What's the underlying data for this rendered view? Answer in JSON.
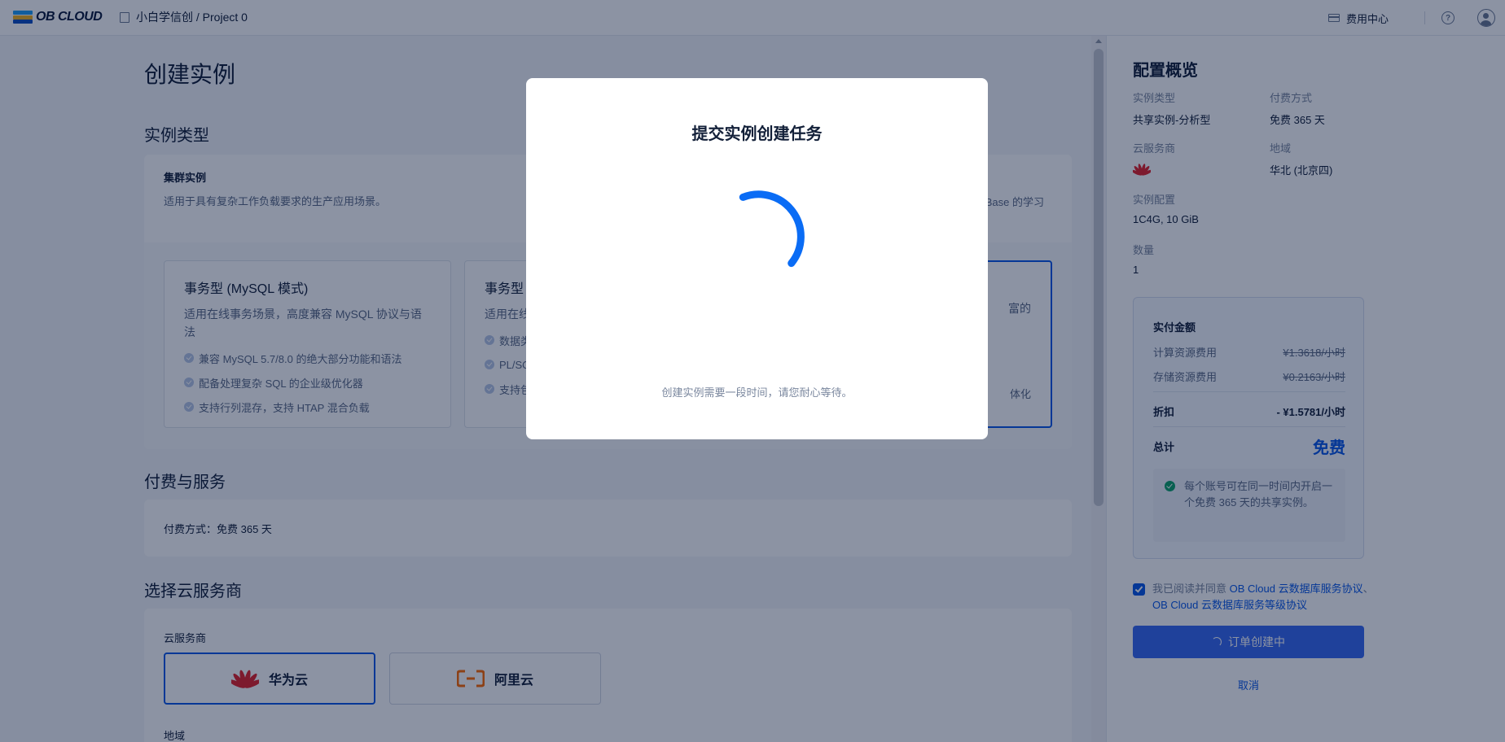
{
  "topbar": {
    "logo_text": "OB CLOUD",
    "project": "小白学信创 / Project 0",
    "billing": "费用中心",
    "help_glyph": "?"
  },
  "main": {
    "page_title": "创建实例",
    "instance_type": {
      "section": "实例类型",
      "cluster_title": "集群实例",
      "cluster_desc": "适用于具有复杂工作负载要求的生产应用场景。",
      "right_clip": "Base 的学习",
      "cards": [
        {
          "title": "事务型 (MySQL 模式)",
          "desc": "适用在线事务场景，高度兼容 MySQL 协议与语法",
          "features": [
            "兼容 MySQL 5.7/8.0 的绝大部分功能和语法",
            "配备处理复杂 SQL 的企业级优化器",
            "支持行列混存，支持 HTAP 混合负载"
          ]
        },
        {
          "title": "事务型",
          "desc": "适用在线",
          "features": [
            "数据类",
            "PL/SQ",
            "支持包"
          ]
        },
        {
          "title": "",
          "desc": "富的",
          "features": [
            "体化"
          ]
        }
      ]
    },
    "payment": {
      "section": "付费与服务",
      "text": "付费方式：免费 365 天"
    },
    "cloud": {
      "section": "选择云服务商",
      "label": "云服务商",
      "providers": [
        "华为云",
        "阿里云"
      ],
      "region_label": "地域"
    }
  },
  "sidebar": {
    "title": "配置概览",
    "instance_type_k": "实例类型",
    "instance_type_v": "共享实例-分析型",
    "pay_k": "付费方式",
    "pay_v": "免费 365 天",
    "provider_k": "云服务商",
    "region_k": "地域",
    "region_v": "华北 (北京四)",
    "spec_k": "实例配置",
    "spec_v": "1C4G, 10 GiB",
    "qty_k": "数量",
    "qty_v": "1",
    "price": {
      "title": "实付金额",
      "compute_k": "计算资源费用",
      "compute_v": "¥1.3618/小时",
      "storage_k": "存储资源费用",
      "storage_v": "¥0.2163/小时",
      "discount_k": "折扣",
      "discount_v": "- ¥1.5781/小时",
      "total_k": "总计",
      "total_v": "免费",
      "notice": "每个账号可在同一时间内开启一个免费 365 天的共享实例。"
    },
    "agree_prefix": "我已阅读并同意",
    "agree_link1": "OB Cloud 云数据库服务协议",
    "agree_sep": "、",
    "agree_link2": "OB Cloud 云数据库服务等级协议",
    "submit": "订单创建中",
    "cancel": "取消"
  },
  "modal": {
    "title": "提交实例创建任务",
    "hint": "创建实例需要一段时间，请您耐心等待。"
  },
  "colors": {
    "accent": "#0a58e8",
    "success": "#0fa36b",
    "huawei": "#e3242b",
    "aliyun": "#ff6a00"
  }
}
